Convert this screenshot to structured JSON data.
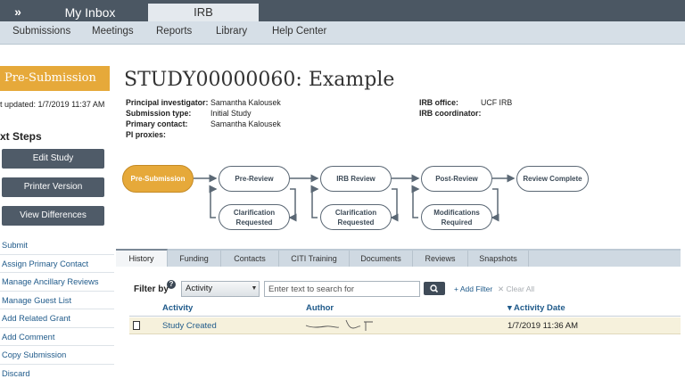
{
  "topbar": {
    "expand_label": "»",
    "tabs": [
      {
        "label": "My Inbox"
      },
      {
        "label": "IRB"
      }
    ]
  },
  "subnav": {
    "items": [
      {
        "label": "Submissions"
      },
      {
        "label": "Meetings"
      },
      {
        "label": "Reports"
      },
      {
        "label": "Library"
      },
      {
        "label": "Help Center"
      }
    ]
  },
  "sidebar": {
    "status": "Pre-Submission",
    "last_updated": "t updated:  1/7/2019 11:37 AM",
    "next_steps_heading": "xt Steps",
    "buttons": [
      {
        "label": "Edit Study"
      },
      {
        "label": "Printer Version"
      },
      {
        "label": "View Differences"
      }
    ],
    "links": [
      {
        "label": "Submit"
      },
      {
        "label": "Assign Primary Contact"
      },
      {
        "label": "Manage Ancillary Reviews"
      },
      {
        "label": "Manage Guest List"
      },
      {
        "label": "Add Related Grant"
      },
      {
        "label": "Add Comment"
      },
      {
        "label": "Copy Submission"
      },
      {
        "label": "Discard"
      }
    ]
  },
  "study": {
    "title": "STUDY00000060: Example",
    "fields": [
      {
        "label": "Principal investigator:",
        "value": "Samantha Kalousek"
      },
      {
        "label": "Submission type:",
        "value": "Initial Study"
      },
      {
        "label": "Primary contact:",
        "value": "Samantha Kalousek"
      },
      {
        "label": "PI proxies:",
        "value": ""
      }
    ],
    "irb_fields": [
      {
        "label": "IRB office:",
        "value": "UCF IRB"
      },
      {
        "label": "IRB coordinator:",
        "value": ""
      }
    ]
  },
  "workflow": {
    "steps": [
      {
        "label": "Pre-Submission",
        "state": "current"
      },
      {
        "label": "Pre-Review",
        "state": "pending"
      },
      {
        "label": "IRB Review",
        "state": "pending"
      },
      {
        "label": "Post-Review",
        "state": "pending"
      },
      {
        "label": "Review Complete",
        "state": "pending"
      }
    ],
    "side_steps": [
      {
        "label_line1": "Clarification",
        "label_line2": "Requested"
      },
      {
        "label_line1": "Clarification",
        "label_line2": "Requested"
      },
      {
        "label_line1": "Modifications",
        "label_line2": "Required"
      }
    ],
    "colors": {
      "current": "#e6a93a",
      "border": "#5b6875"
    }
  },
  "tabs": {
    "items": [
      {
        "label": "History",
        "active": true
      },
      {
        "label": "Funding"
      },
      {
        "label": "Contacts"
      },
      {
        "label": "CITI Training"
      },
      {
        "label": "Documents"
      },
      {
        "label": "Reviews"
      },
      {
        "label": "Snapshots"
      }
    ]
  },
  "filter": {
    "label": "Filter by",
    "help_icon": "?",
    "select_value": "Activity",
    "search_placeholder": "Enter text to search for",
    "add_filter": "+ Add Filter",
    "clear_all": "✕ Clear All"
  },
  "history_table": {
    "columns": [
      {
        "label": "Activity"
      },
      {
        "label": "Author"
      },
      {
        "label": "▾ Activity Date"
      }
    ],
    "rows": [
      {
        "activity": "Study Created",
        "author": "",
        "date": "1/7/2019 11:36 AM"
      }
    ]
  }
}
